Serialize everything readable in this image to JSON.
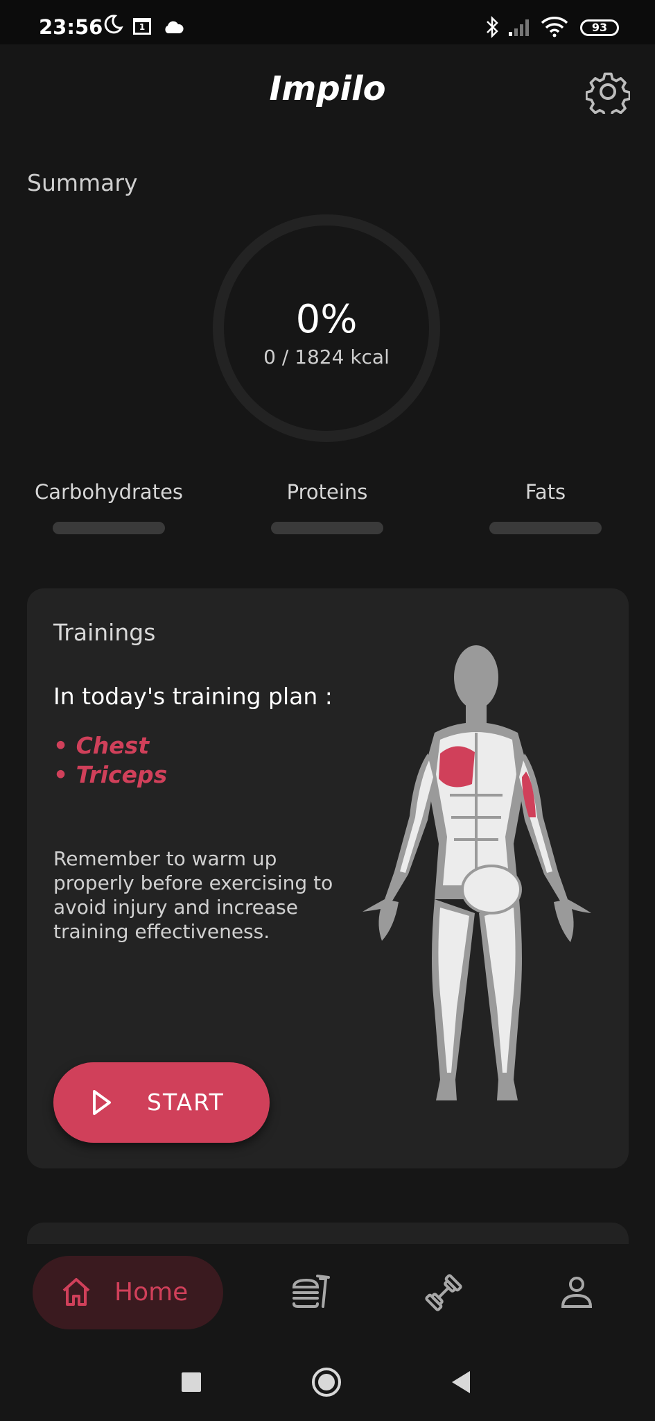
{
  "status_bar": {
    "time": "23:56",
    "battery": "93",
    "calendar_day": "1",
    "icons": [
      "moon-icon",
      "calendar-icon",
      "cloud-icon",
      "bluetooth-icon",
      "signal-icon",
      "wifi-icon",
      "battery-icon"
    ]
  },
  "app": {
    "title": "Impilo",
    "settings_icon": "gear-icon"
  },
  "summary": {
    "label": "Summary",
    "percent_text": "0%",
    "calories_text": "0 / 1824 kcal",
    "progress": 0,
    "macros": [
      {
        "label": "Carbohydrates",
        "progress": 0
      },
      {
        "label": "Proteins",
        "progress": 0
      },
      {
        "label": "Fats",
        "progress": 0
      }
    ]
  },
  "trainings": {
    "title": "Trainings",
    "plan_heading": "In today's training plan :",
    "muscles": [
      "• Chest",
      "• Triceps"
    ],
    "tip": "Remember to warm up properly before exercising to avoid injury and increase training effectiveness.",
    "start_label": "START",
    "start_icon": "play-icon",
    "figure_icon": "body-muscle-figure-icon"
  },
  "bottom_nav": {
    "items": [
      {
        "label": "Home",
        "icon": "home-icon",
        "active": true
      },
      {
        "label": "",
        "icon": "meals-icon",
        "active": false
      },
      {
        "label": "",
        "icon": "dumbbell-icon",
        "active": false
      },
      {
        "label": "",
        "icon": "profile-icon",
        "active": false
      }
    ]
  },
  "colors": {
    "background": "#161616",
    "card": "#232323",
    "accent": "#d0405a",
    "track": "#3a3a3a"
  }
}
